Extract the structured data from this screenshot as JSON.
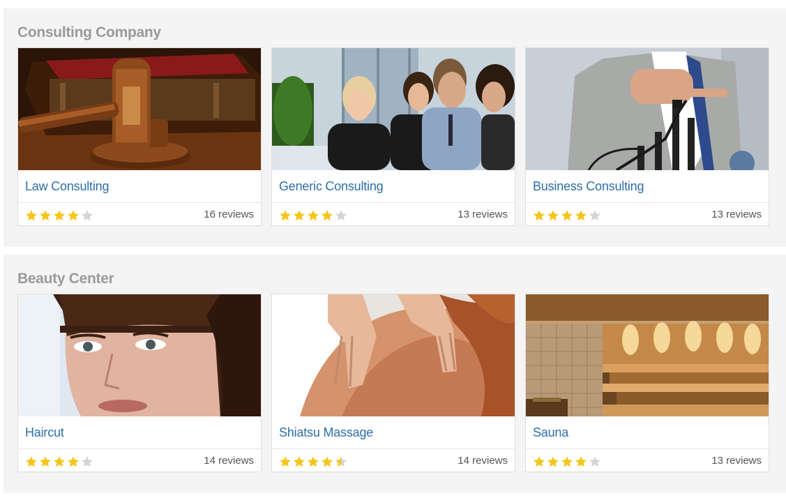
{
  "colors": {
    "star_on": "#f5c518",
    "star_off": "#d4d4d4",
    "title_link": "#2f6ea8",
    "section_heading": "#9a9a9a"
  },
  "sections": [
    {
      "title": "Consulting Company",
      "cards": [
        {
          "title": "Law Consulting",
          "rating": 4,
          "reviews": "16 reviews",
          "image": "gavel-photo"
        },
        {
          "title": "Generic Consulting",
          "rating": 4,
          "reviews": "13 reviews",
          "image": "business-meeting-photo"
        },
        {
          "title": "Business Consulting",
          "rating": 4,
          "reviews": "13 reviews",
          "image": "growth-chart-photo"
        }
      ]
    },
    {
      "title": "Beauty Center",
      "cards": [
        {
          "title": "Haircut",
          "rating": 4,
          "reviews": "14 reviews",
          "image": "woman-portrait-photo"
        },
        {
          "title": "Shiatsu Massage",
          "rating": 4.5,
          "reviews": "14 reviews",
          "image": "massage-photo"
        },
        {
          "title": "Sauna",
          "rating": 4,
          "reviews": "13 reviews",
          "image": "sauna-room-photo"
        }
      ]
    }
  ]
}
